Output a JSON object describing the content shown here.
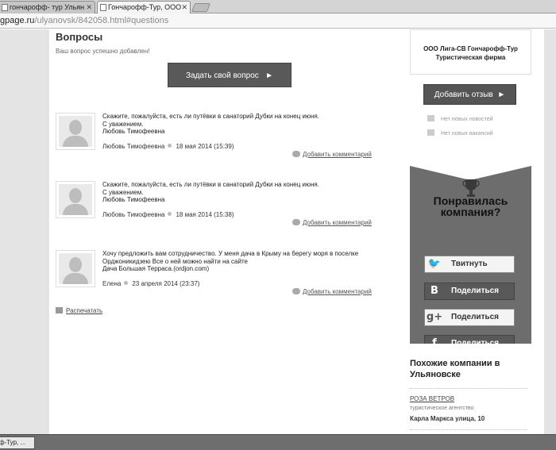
{
  "browser": {
    "tabs": [
      {
        "label": "гончарофф- тур Ульян"
      },
      {
        "label": "Гончарофф-Тур, ООО"
      }
    ],
    "address": {
      "host": "gpage.ru",
      "path": "/ulyanovsk/842058.html#questions"
    }
  },
  "main": {
    "title": "Вопросы",
    "success_message": "Ваш вопрос успешно добавлен!",
    "ask_button": "Задать свой вопрос",
    "questions": [
      {
        "lines": [
          "Скажите, пожалуйста, есть ли путёвки в санаторий Дубки на конец июня.",
          "С уважением.",
          "Любовь Тимофеевна"
        ],
        "author": "Любовь Тимофеевна",
        "date": "18 мая 2014 (15:39)",
        "comment_link": "Добавить комментарий"
      },
      {
        "lines": [
          "Скажите, пожалуйста, есть ли путёвки в санаторий Дубки на конец июня.",
          "С уважением.",
          "Любовь Тимофеевна"
        ],
        "author": "Любовь Тимофеевна",
        "date": "18 мая 2014 (15:38)",
        "comment_link": "Добавить комментарий"
      },
      {
        "lines": [
          "Хочу предложить вам сотрудничество. У меня дача в Крыму на берегу моря в поселке",
          "Орджоникидзею Все о ней можно найти на сайте",
          "Дача Большая Терраса.(ordjon.com)"
        ],
        "author": "Елена",
        "date": "23 апреля 2014 (23:37)",
        "comment_link": "Добавить комментарий"
      }
    ],
    "print_link": "Распечатать"
  },
  "sidebar": {
    "company_name_line1": "ООО Лига-СВ Гончарофф-Тур",
    "company_name_line2": "Туристическая фирма",
    "review_button": "Добавить отзыв",
    "no_news": "Нет новых новостей",
    "no_vacancies": "Нет новых вакансий",
    "like_title_line1": "Понравилась",
    "like_title_line2": "компания?",
    "share_buttons": [
      {
        "icon": "twitter-bird-icon",
        "glyph": "🐦",
        "label": "Твитнуть"
      },
      {
        "icon": "vk-icon",
        "glyph": "В",
        "label": "Поделиться"
      },
      {
        "icon": "google-plus-icon",
        "glyph": "g+",
        "label": "Поделиться"
      },
      {
        "icon": "facebook-icon",
        "glyph": "f",
        "label": "Поделиться"
      }
    ],
    "similar_title_line1": "Похожие компании в",
    "similar_title_line2": "Ульяновске",
    "similar": {
      "name": "РОЗА ВЕТРОВ",
      "type": "туристическое агентство",
      "address": "Карла Маркса улица, 10"
    }
  },
  "taskbar": {
    "item": "ф-Тур, ..."
  }
}
